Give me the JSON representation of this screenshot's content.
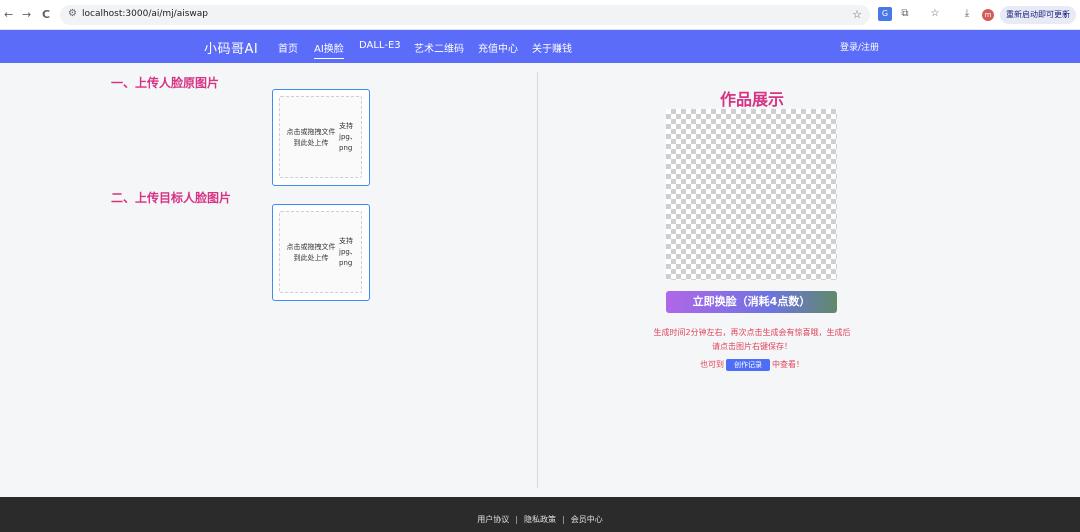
{
  "browser": {
    "back": "←",
    "forward": "→",
    "reload": "C",
    "url": "localhost:3000/ai/mj/aiswap",
    "update_label": "重新启动即可更新",
    "profile_initial": "m"
  },
  "nav": {
    "brand": "小码哥AI",
    "links": [
      "首页",
      "AI换脸",
      "DALL-E3",
      "艺术二维码",
      "充值中心",
      "关于赚钱"
    ],
    "active_index": 1,
    "login": "登录/注册",
    "color": "#5b6cf9"
  },
  "left": {
    "section1_title": "一、上传人脸原图片",
    "section2_title": "二、上传目标人脸图片",
    "upload_text": "点击或拖拽文件到此处上传",
    "upload_hint": "支持jpg、png"
  },
  "right": {
    "title": "作品展示",
    "swap_button": "立即换脸（消耗4点数）",
    "notice": "生成时间2分钟左右，再次点击生成会有惊喜哦，生成后请点击图片右键保存！",
    "notice2_prefix": "也可到",
    "record_button": "创作记录",
    "notice2_suffix": "中查看！"
  },
  "footer": {
    "links": [
      "用户协议",
      "隐私政策",
      "会员中心"
    ]
  },
  "colors": {
    "accent": "#d63384",
    "nav": "#5b6cf9",
    "warning_text": "#e0445a",
    "upload_border": "#3f8cf0"
  }
}
